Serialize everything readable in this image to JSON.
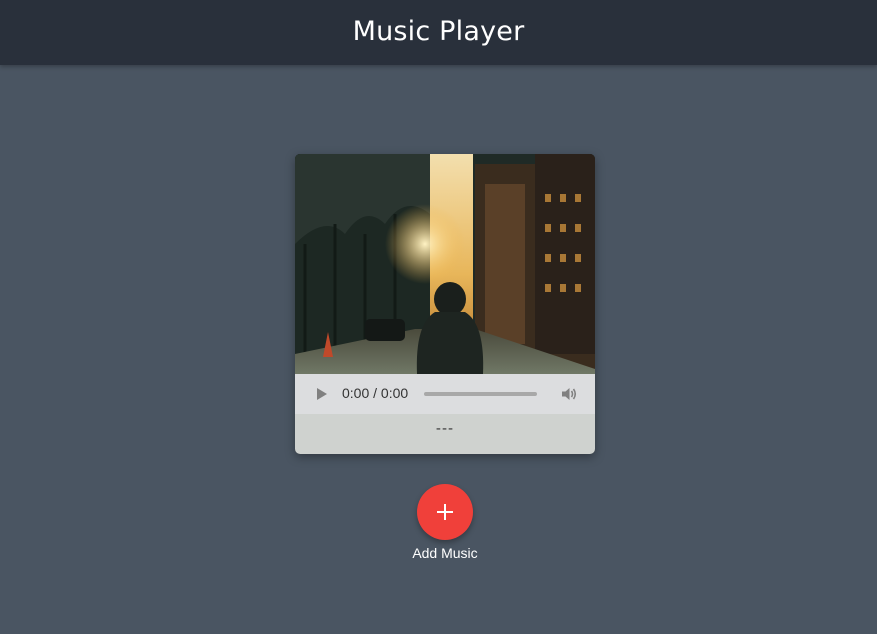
{
  "header": {
    "title": "Music Player"
  },
  "player": {
    "current_time": "0:00 / 0:00",
    "track_name": "---",
    "progress": 0
  },
  "actions": {
    "add_music_label": "Add Music",
    "add_icon": "plus-icon"
  },
  "colors": {
    "header_bg": "#29303b",
    "page_bg": "#4a5562",
    "accent": "#f0403a"
  }
}
